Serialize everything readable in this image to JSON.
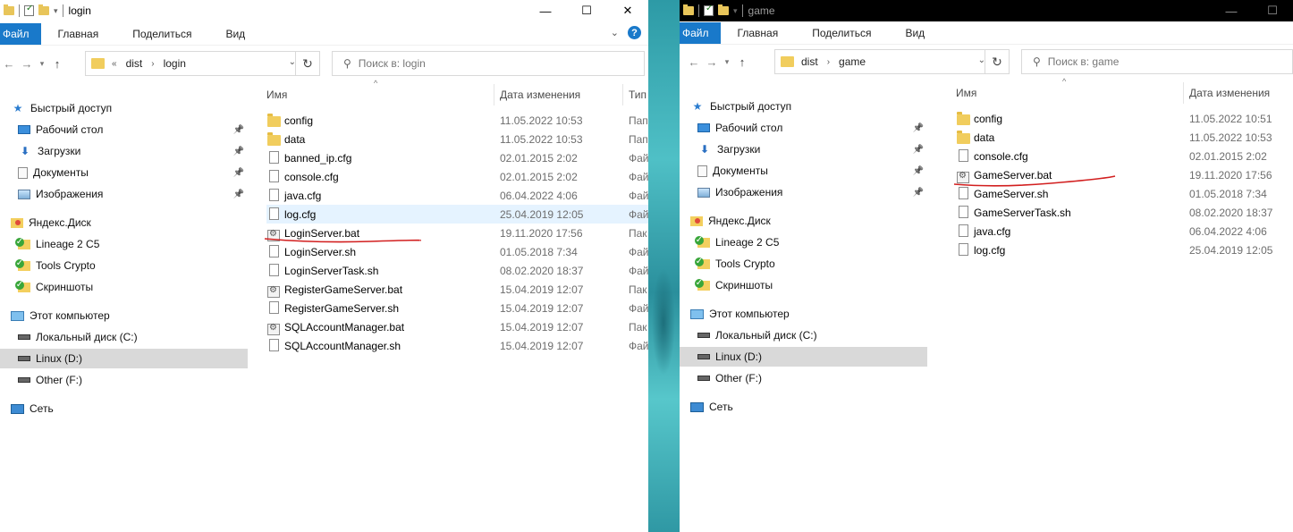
{
  "left_window": {
    "title": "login",
    "ribbon": {
      "file": "Файл",
      "tabs": [
        "Главная",
        "Поделиться",
        "Вид"
      ]
    },
    "address": {
      "overflow": "«",
      "crumbs": [
        "dist",
        "login"
      ]
    },
    "search_placeholder": "Поиск в: login",
    "columns": {
      "name": "Имя",
      "date": "Дата изменения",
      "type": "Тип"
    },
    "nav": [
      {
        "label": "Быстрый доступ",
        "icon": "star-icon"
      },
      {
        "label": "Рабочий стол",
        "icon": "desktop-icon",
        "pinned": true
      },
      {
        "label": "Загрузки",
        "icon": "download-icon",
        "pinned": true
      },
      {
        "label": "Документы",
        "icon": "documents-icon",
        "pinned": true
      },
      {
        "label": "Изображения",
        "icon": "pictures-icon",
        "pinned": true
      },
      {
        "label": "Яндекс.Диск",
        "icon": "yandex-disk-icon"
      },
      {
        "label": "Lineage 2 C5",
        "icon": "synced-folder-icon"
      },
      {
        "label": "Tools Crypto",
        "icon": "synced-folder-icon"
      },
      {
        "label": "Скриншоты",
        "icon": "synced-folder-icon"
      },
      {
        "label": "Этот компьютер",
        "icon": "computer-icon"
      },
      {
        "label": "Локальный диск (C:)",
        "icon": "drive-icon"
      },
      {
        "label": "Linux (D:)",
        "icon": "drive-icon",
        "selected": true
      },
      {
        "label": "Other (F:)",
        "icon": "drive-icon"
      },
      {
        "label": "Сеть",
        "icon": "network-icon"
      }
    ],
    "files": [
      {
        "name": "config",
        "date": "11.05.2022 10:53",
        "type": "Папк",
        "icon": "folder"
      },
      {
        "name": "data",
        "date": "11.05.2022 10:53",
        "type": "Папк",
        "icon": "folder"
      },
      {
        "name": "banned_ip.cfg",
        "date": "02.01.2015 2:02",
        "type": "Файл",
        "icon": "file"
      },
      {
        "name": "console.cfg",
        "date": "02.01.2015 2:02",
        "type": "Файл",
        "icon": "file"
      },
      {
        "name": "java.cfg",
        "date": "06.04.2022 4:06",
        "type": "Файл",
        "icon": "file"
      },
      {
        "name": "log.cfg",
        "date": "25.04.2019 12:05",
        "type": "Файл",
        "icon": "file",
        "hover": true
      },
      {
        "name": "LoginServer.bat",
        "date": "19.11.2020 17:56",
        "type": "Пак",
        "icon": "bat"
      },
      {
        "name": "LoginServer.sh",
        "date": "01.05.2018 7:34",
        "type": "Файл",
        "icon": "file"
      },
      {
        "name": "LoginServerTask.sh",
        "date": "08.02.2020 18:37",
        "type": "Файл",
        "icon": "file"
      },
      {
        "name": "RegisterGameServer.bat",
        "date": "15.04.2019 12:07",
        "type": "Пак",
        "icon": "bat"
      },
      {
        "name": "RegisterGameServer.sh",
        "date": "15.04.2019 12:07",
        "type": "Файл",
        "icon": "file"
      },
      {
        "name": "SQLAccountManager.bat",
        "date": "15.04.2019 12:07",
        "type": "Пак",
        "icon": "bat"
      },
      {
        "name": "SQLAccountManager.sh",
        "date": "15.04.2019 12:07",
        "type": "Файл",
        "icon": "file"
      }
    ]
  },
  "right_window": {
    "title": "game",
    "ribbon": {
      "file": "Файл",
      "tabs": [
        "Главная",
        "Поделиться",
        "Вид"
      ]
    },
    "address": {
      "crumbs": [
        "dist",
        "game"
      ]
    },
    "search_placeholder": "Поиск в: game",
    "columns": {
      "name": "Имя",
      "date": "Дата изменения"
    },
    "nav": [
      {
        "label": "Быстрый доступ",
        "icon": "star-icon"
      },
      {
        "label": "Рабочий стол",
        "icon": "desktop-icon",
        "pinned": true
      },
      {
        "label": "Загрузки",
        "icon": "download-icon",
        "pinned": true
      },
      {
        "label": "Документы",
        "icon": "documents-icon",
        "pinned": true
      },
      {
        "label": "Изображения",
        "icon": "pictures-icon",
        "pinned": true
      },
      {
        "label": "Яндекс.Диск",
        "icon": "yandex-disk-icon"
      },
      {
        "label": "Lineage 2 C5",
        "icon": "synced-folder-icon"
      },
      {
        "label": "Tools Crypto",
        "icon": "synced-folder-icon"
      },
      {
        "label": "Скриншоты",
        "icon": "synced-folder-icon"
      },
      {
        "label": "Этот компьютер",
        "icon": "computer-icon"
      },
      {
        "label": "Локальный диск (C:)",
        "icon": "drive-icon"
      },
      {
        "label": "Linux (D:)",
        "icon": "drive-icon",
        "selected": true
      },
      {
        "label": "Other (F:)",
        "icon": "drive-icon"
      },
      {
        "label": "Сеть",
        "icon": "network-icon"
      }
    ],
    "files": [
      {
        "name": "config",
        "date": "11.05.2022 10:51",
        "icon": "folder"
      },
      {
        "name": "data",
        "date": "11.05.2022 10:53",
        "icon": "folder"
      },
      {
        "name": "console.cfg",
        "date": "02.01.2015 2:02",
        "icon": "file"
      },
      {
        "name": "GameServer.bat",
        "date": "19.11.2020 17:56",
        "icon": "bat"
      },
      {
        "name": "GameServer.sh",
        "date": "01.05.2018 7:34",
        "icon": "file"
      },
      {
        "name": "GameServerTask.sh",
        "date": "08.02.2020 18:37",
        "icon": "file"
      },
      {
        "name": "java.cfg",
        "date": "06.04.2022 4:06",
        "icon": "file"
      },
      {
        "name": "log.cfg",
        "date": "25.04.2019 12:05",
        "icon": "file"
      }
    ]
  },
  "colors": {
    "accent": "#1979ca",
    "annotation": "#d21f1f",
    "selected_bg": "#d9d9d9",
    "hover_bg": "#e5f3ff"
  }
}
